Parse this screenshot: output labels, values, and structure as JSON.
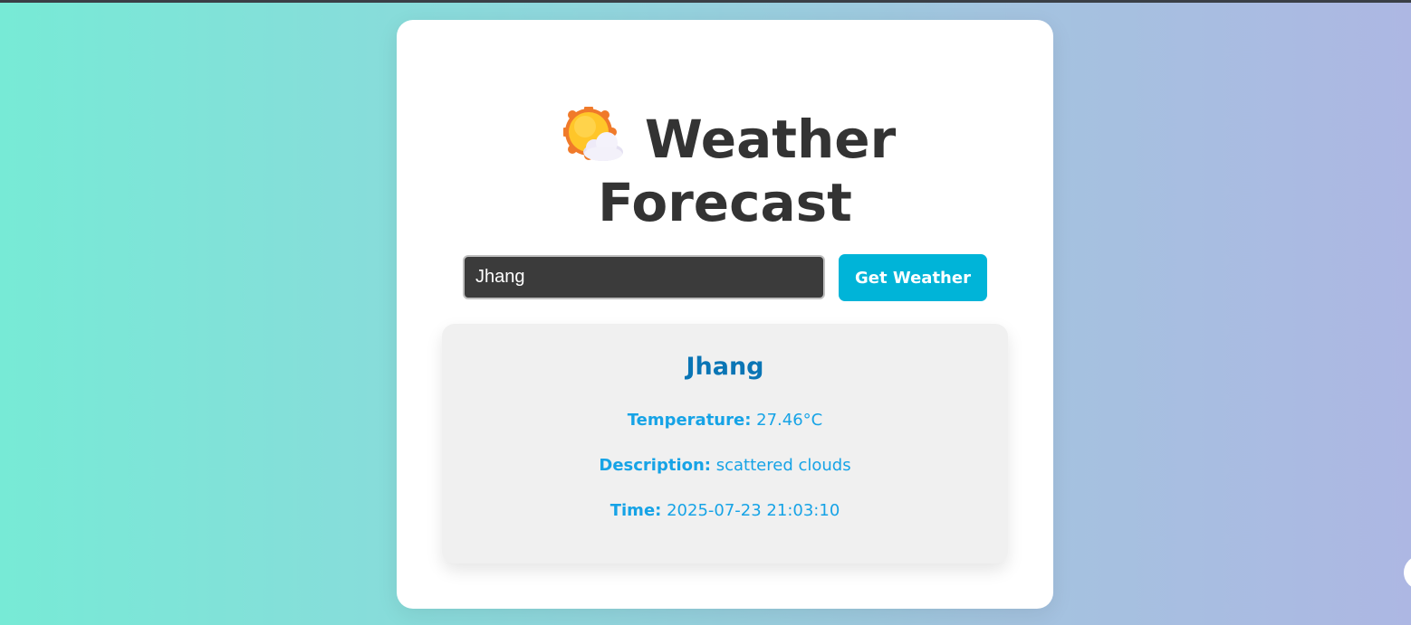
{
  "app": {
    "title": "Weather Forecast",
    "title_line1": "Weather",
    "title_line2": "Forecast",
    "title_icon": "sun-behind-cloud-icon"
  },
  "search": {
    "value": "Jhang",
    "button_label": "Get Weather"
  },
  "result": {
    "city": "Jhang",
    "temperature_label": "Temperature:",
    "temperature_value": "27.46°C",
    "description_label": "Description:",
    "description_value": "scattered clouds",
    "time_label": "Time:",
    "time_value": "2025-07-23 21:03:10"
  },
  "colors": {
    "background_start": "#77ead6",
    "background_end": "#adb7e3",
    "title": "#333333",
    "button": "#00b4d8",
    "city": "#0a75b5",
    "detail_text": "#16a3e6",
    "input_bg": "#3b3b3b",
    "result_bg": "#f0f0f0"
  }
}
